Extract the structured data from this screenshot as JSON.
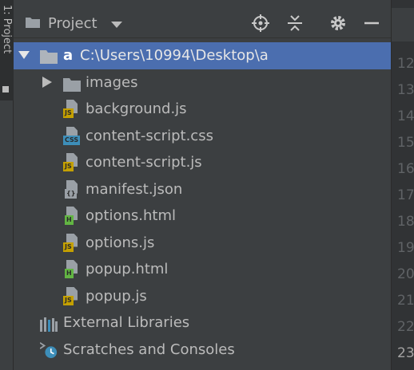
{
  "side_tab": {
    "label": "1: Project"
  },
  "toolbar": {
    "title": "Project",
    "icons": [
      "locate-icon",
      "collapse-all-icon",
      "settings-icon",
      "minimize-icon"
    ]
  },
  "tree": {
    "root": {
      "name": "a",
      "path": "C:\\Users\\10994\\Desktop\\a"
    },
    "folder": {
      "name": "images"
    },
    "files": [
      {
        "name": "background.js",
        "badge": "JS"
      },
      {
        "name": "content-script.css",
        "badge": "CSS"
      },
      {
        "name": "content-script.js",
        "badge": "JS"
      },
      {
        "name": "manifest.json",
        "badge": "{}"
      },
      {
        "name": "options.html",
        "badge": "H"
      },
      {
        "name": "options.js",
        "badge": "JS"
      },
      {
        "name": "popup.html",
        "badge": "H"
      },
      {
        "name": "popup.js",
        "badge": "JS"
      }
    ],
    "external_libraries": "External Libraries",
    "scratches": "Scratches and Consoles"
  },
  "editor": {
    "line_numbers": [
      "12",
      "13",
      "14",
      "15",
      "16",
      "17",
      "18",
      "19",
      "20",
      "21",
      "22",
      "23"
    ],
    "current_line": "23"
  },
  "colors": {
    "background": "#3c3f41",
    "selection": "#4b6eaf",
    "js_badge": "#c4a000",
    "css_badge": "#3d8eb9",
    "html_badge": "#62b543",
    "json_badge": "#9aa0a6"
  }
}
